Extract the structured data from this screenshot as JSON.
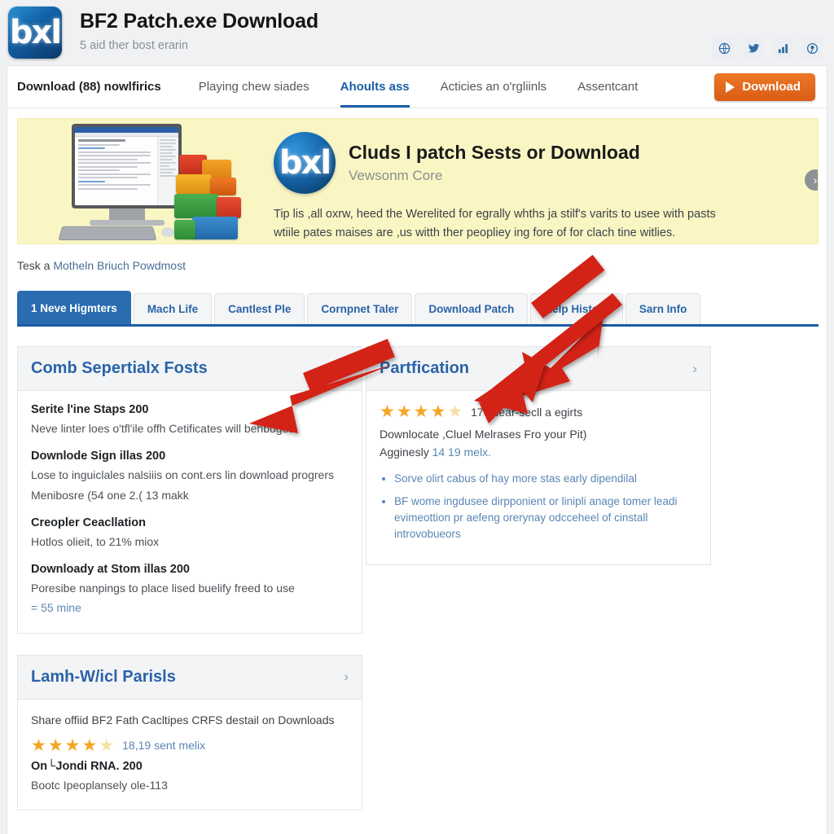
{
  "header": {
    "logo_glyph": "bxl",
    "title": "BF2 Patch.exe Download",
    "subtitle": "5 aid ther bost erarin",
    "social": [
      {
        "name": "globe-icon",
        "label": "@"
      },
      {
        "name": "twitter-icon",
        "label": "t"
      },
      {
        "name": "chart-icon",
        "label": "chart"
      },
      {
        "name": "pin-icon",
        "label": "pin"
      }
    ]
  },
  "top_nav": {
    "links": [
      {
        "label": "Download (88) nowlfirics",
        "state": "first"
      },
      {
        "label": "Playing chew siades",
        "state": "normal"
      },
      {
        "label": "Ahoults ass",
        "state": "active"
      },
      {
        "label": "Acticies an o'rgliinls",
        "state": "normal"
      },
      {
        "label": "Assentcant",
        "state": "normal"
      }
    ],
    "download_button": "Download"
  },
  "banner": {
    "logo_glyph": "bxl",
    "title": "Cluds I patch Sests or Download",
    "subtitle": "Vewsonm Core",
    "body_line1": "Tip lis ,all oxrw, heed the Werelited for egrally whths ja stilf's varits to usee with pasts",
    "body_line2": "wtiile pates maises are ,us witth ther peopliey ing fore of for clach tine witlies.",
    "next_arrow": "›"
  },
  "breadcrumb": {
    "prefix": "Tesk a ",
    "link": "Motheln Briuch Powdmost"
  },
  "tabs": [
    {
      "label": "1 Neve Higmters",
      "active": true
    },
    {
      "label": "Mach Life",
      "active": false
    },
    {
      "label": "Cantlest Ple",
      "active": false
    },
    {
      "label": "Cornpnet Taler",
      "active": false
    },
    {
      "label": "Download Patch",
      "active": false
    },
    {
      "label": "Help History",
      "active": false
    },
    {
      "label": "Sarn Info",
      "active": false
    }
  ],
  "panels": {
    "left_top": {
      "title": "Comb Sepertialx Fosts",
      "chevron": "›",
      "items": [
        {
          "title": "Serite l'ine Staps 200",
          "desc": "Neve linter loes o'tfl'ile offh Cetificates will behbuges",
          "meta": ""
        },
        {
          "title": "Downlode Sign illas 200",
          "desc": "Lose to inguiclales nalsiiis on cont.ers lin download progrers",
          "meta": "Menibosre (54 one 2.( 13 makk"
        },
        {
          "title": "Creopler Ceacllation",
          "desc": "Hotlos olieit, to 21% miox",
          "meta": ""
        },
        {
          "title": "Downloady at Stom illas 200",
          "desc": "Poresibe nanpings to place lised buelify freed to use",
          "meta": "= 55 mine"
        }
      ]
    },
    "right_top": {
      "title": "Partfication",
      "chevron": "›",
      "rating": {
        "stars_filled": 4,
        "stars_total": 5,
        "count_label": "176 sear-secll a egirts"
      },
      "line1": "Downlocate ,Cluel Melrases Fro your Pit)",
      "line2_prefix": "Agginesly ",
      "line2_link": "14 19 melx.",
      "bullets": [
        "Sorve olirt cabus of hay more stas early dipendilal",
        "BF wome ingdusee dirpponient or linipli anage tomer leadi evimeottion pr aefeng orerynay odcceheel of cinstall introvobueors"
      ]
    },
    "left_bottom": {
      "title": "Lamh-W/icl Parisls",
      "chevron": "›",
      "share_text": "Share offiid BF2 Fath Cacltipes CRFS destail on Downloads",
      "rating": {
        "stars_filled": 4,
        "stars_total": 5,
        "count_label": "18,19 sent melix"
      },
      "item_title": "On└Jondi RNA. 200",
      "item_desc": "Bootc Ipeoplansely ole-113"
    }
  },
  "colors": {
    "accent_blue": "#2a6cb0",
    "link_blue": "#5b86b5",
    "download_orange": "#d95d16",
    "banner_yellow": "#faf6c4",
    "star_gold": "#f5a623",
    "annotation_red": "#d32215"
  }
}
